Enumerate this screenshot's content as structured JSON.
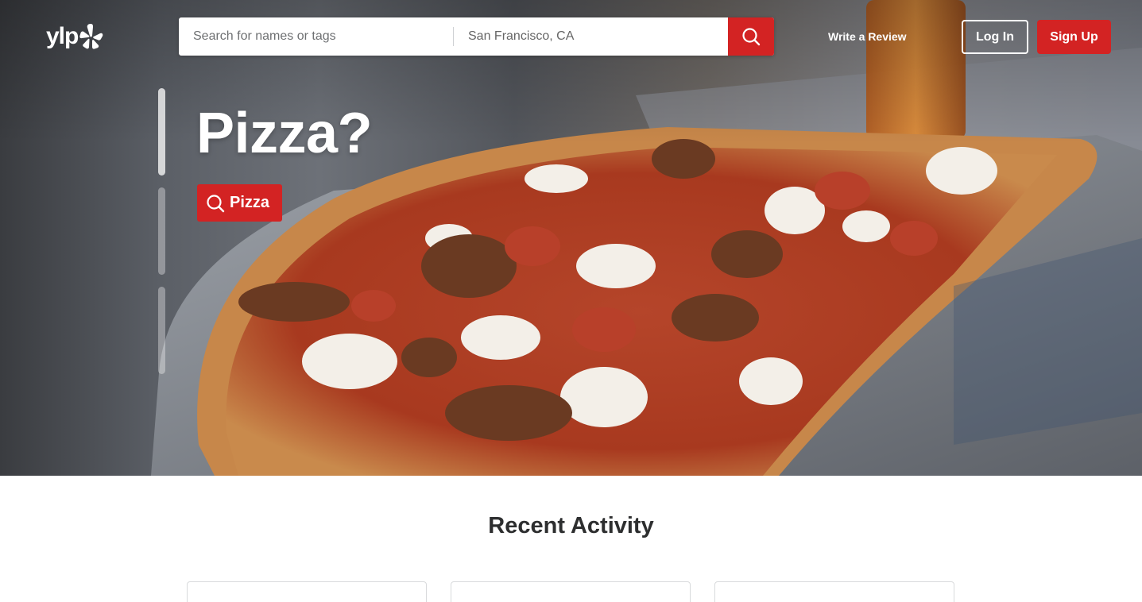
{
  "header": {
    "logo_text": "ylp",
    "search": {
      "find_placeholder": "Search for names or tags",
      "near_value": "San Francisco, CA"
    },
    "write_review_label": "Write a Review",
    "login_label": "Log In",
    "signup_label": "Sign Up"
  },
  "hero": {
    "title": "Pizza?",
    "cta_label": "Pizza",
    "slides_total": 3,
    "active_slide": 1
  },
  "recent_activity": {
    "title": "Recent Activity",
    "cards_visible": 3
  },
  "colors": {
    "brand_red": "#d32323",
    "heading_text": "#2d2e2f"
  },
  "icons": {
    "search": "search-icon",
    "logo_burst": "yelp-burst-icon"
  }
}
